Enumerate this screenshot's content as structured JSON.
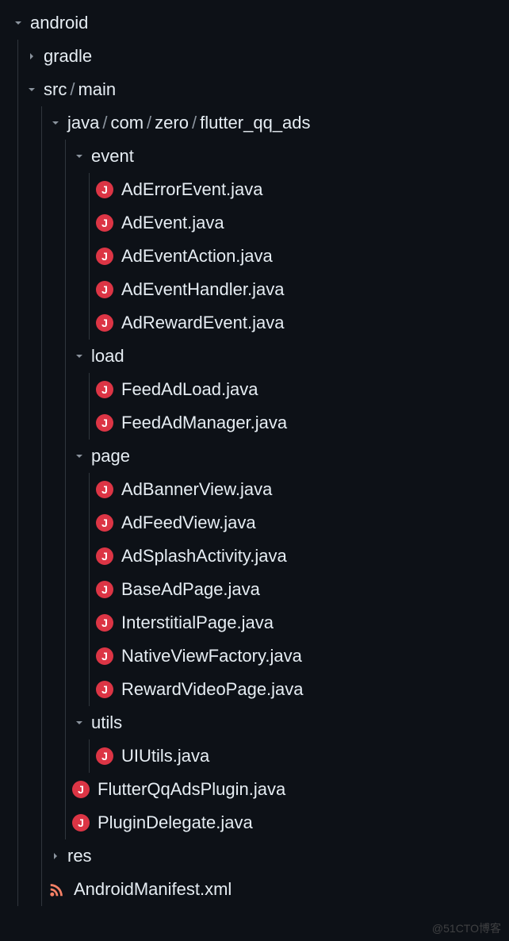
{
  "tree": {
    "root": {
      "name": "android",
      "children": [
        {
          "name": "gradle",
          "type": "folder-collapsed"
        },
        {
          "name": "src/main",
          "type": "folder-open",
          "pathParts": [
            "src",
            "main"
          ],
          "children": [
            {
              "name": "java/com/zero/flutter_qq_ads",
              "type": "folder-open",
              "pathParts": [
                "java",
                "com",
                "zero",
                "flutter_qq_ads"
              ],
              "children": [
                {
                  "name": "event",
                  "type": "folder-open",
                  "children": [
                    {
                      "name": "AdErrorEvent.java",
                      "type": "java"
                    },
                    {
                      "name": "AdEvent.java",
                      "type": "java"
                    },
                    {
                      "name": "AdEventAction.java",
                      "type": "java"
                    },
                    {
                      "name": "AdEventHandler.java",
                      "type": "java"
                    },
                    {
                      "name": "AdRewardEvent.java",
                      "type": "java"
                    }
                  ]
                },
                {
                  "name": "load",
                  "type": "folder-open",
                  "children": [
                    {
                      "name": "FeedAdLoad.java",
                      "type": "java"
                    },
                    {
                      "name": "FeedAdManager.java",
                      "type": "java"
                    }
                  ]
                },
                {
                  "name": "page",
                  "type": "folder-open",
                  "children": [
                    {
                      "name": "AdBannerView.java",
                      "type": "java"
                    },
                    {
                      "name": "AdFeedView.java",
                      "type": "java"
                    },
                    {
                      "name": "AdSplashActivity.java",
                      "type": "java"
                    },
                    {
                      "name": "BaseAdPage.java",
                      "type": "java"
                    },
                    {
                      "name": "InterstitialPage.java",
                      "type": "java"
                    },
                    {
                      "name": "NativeViewFactory.java",
                      "type": "java"
                    },
                    {
                      "name": "RewardVideoPage.java",
                      "type": "java"
                    }
                  ]
                },
                {
                  "name": "utils",
                  "type": "folder-open",
                  "children": [
                    {
                      "name": "UIUtils.java",
                      "type": "java"
                    }
                  ]
                },
                {
                  "name": "FlutterQqAdsPlugin.java",
                  "type": "java"
                },
                {
                  "name": "PluginDelegate.java",
                  "type": "java"
                }
              ]
            },
            {
              "name": "res",
              "type": "folder-collapsed"
            },
            {
              "name": "AndroidManifest.xml",
              "type": "xml"
            }
          ]
        }
      ]
    }
  },
  "iconGlyph": {
    "java": "J"
  },
  "watermark": "@51CTO博客"
}
